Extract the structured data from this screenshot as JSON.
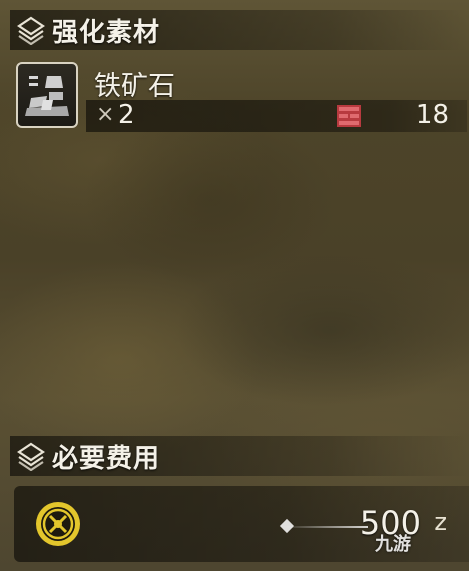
{
  "sections": {
    "materials_title": "强化素材",
    "cost_title": "必要费用"
  },
  "material": {
    "name": "铁矿石",
    "qty_symbol": "×",
    "qty": "2",
    "owned": "18",
    "icon": "ore-icon",
    "owned_icon": "item-box-icon"
  },
  "cost": {
    "value": "500",
    "unit": "z",
    "icon": "zenny-coin-icon",
    "watermark": "九游"
  },
  "colors": {
    "text": "#f4f1e8",
    "coin_gold": "#e3c62c",
    "box_red": "#b83a3f"
  }
}
